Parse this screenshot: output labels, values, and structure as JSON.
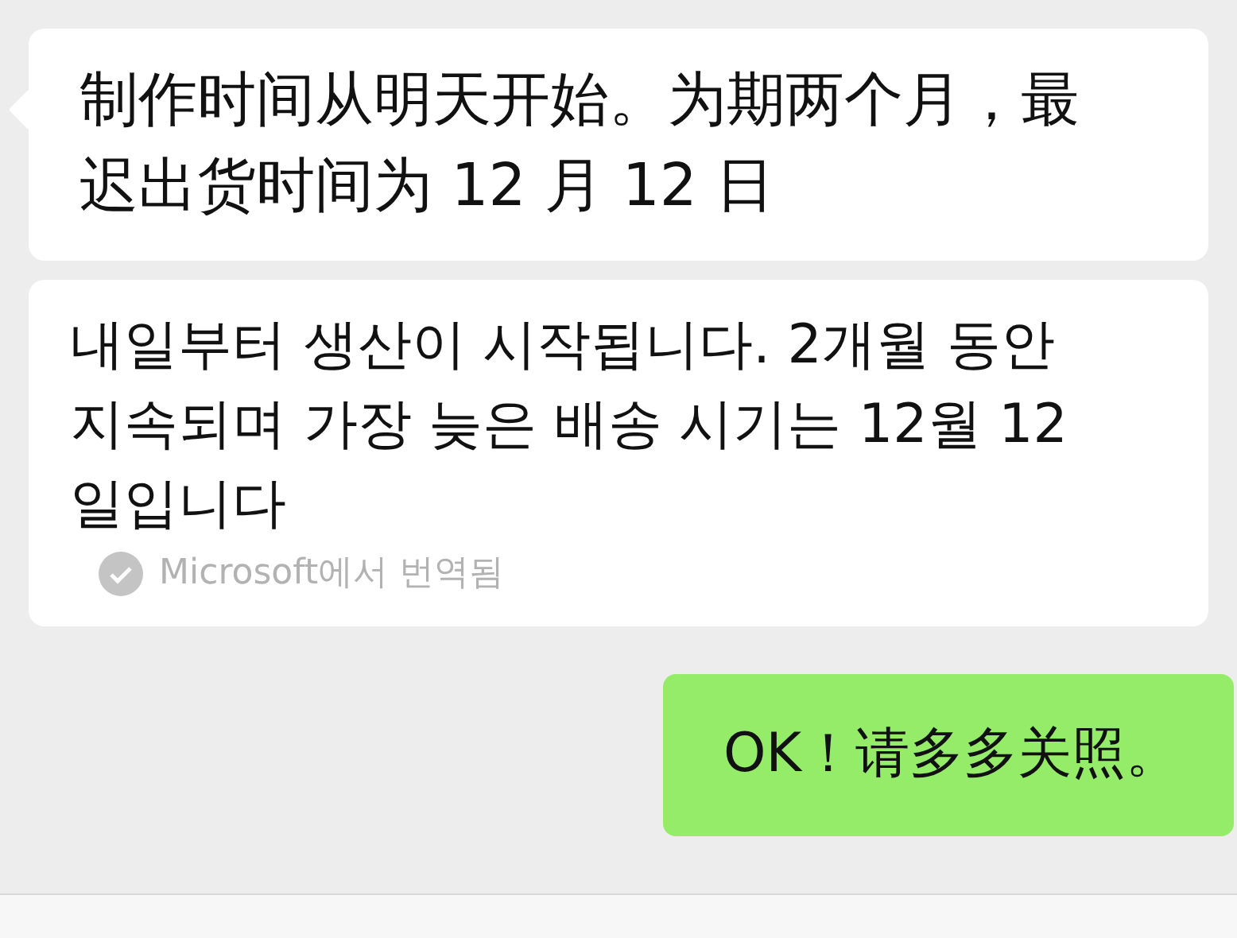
{
  "messages": [
    {
      "kind": "incoming",
      "text": "制作时间从明天开始。为期两个月，最迟出货时间为 12 月 12 日"
    },
    {
      "kind": "translation",
      "text": "내일부터 생산이 시작됩니다. 2개월 동안 지속되며 가장 늦은 배송 시기는 12월 12일입니다",
      "note": "Microsoft에서 번역됨"
    },
    {
      "kind": "outgoing",
      "text": "OK！请多多关照。"
    }
  ]
}
